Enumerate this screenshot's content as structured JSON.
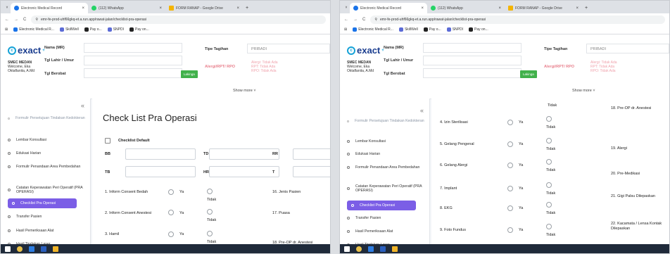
{
  "tabs": [
    {
      "label": "Electronic Medical Record",
      "fav": "#1a73e8"
    },
    {
      "label": "(112) WhatsApp",
      "fav": "#25d366"
    },
    {
      "label": "FORM RANAP - Google Drive",
      "fav": "#f4b400"
    }
  ],
  "caret": "˅",
  "close": "×",
  "plus": "+",
  "nav": {
    "back": "←",
    "fwd": "→",
    "reload": "C",
    "site": "⚲"
  },
  "url": {
    "left": "emr-fe-prod-uhf66gkq-et.a.run.app/rawat-jalan/checklist-pra-operasi",
    "right": "emr-fe-prod-uhf66gkq-et.a.run.app/rawat-jalan/checklist-pra-operasi"
  },
  "bookmarks": [
    {
      "label": "Electronic Medical R...",
      "c": "#1a73e8"
    },
    {
      "label": "SkillWell",
      "c": "#5b6bd6"
    },
    {
      "label": "Pay o...",
      "c": "#222"
    },
    {
      "label": "SNPDI",
      "c": "#5b6bd6"
    },
    {
      "label": "Pay on...",
      "c": "#222"
    }
  ],
  "apps_icon": "⊞",
  "header": {
    "logo": "exact",
    "logo_sup": "+",
    "logo_ring": "c",
    "hospital": "SMEC MEDAN",
    "welcome": "Welcome, Eka",
    "user": "Oktaflanita, A.Md",
    "nama": "Nama (MR)",
    "tgl_lahir": "Tgl Lahir / Umur",
    "tgl_berobat": "Tgl Berobat",
    "btn": "Lakinga",
    "tipe_label": "Tipe Tagihan",
    "tipe_val": "PRIBADI",
    "alert_label": "Alergi/RPT/ RPO",
    "alerts": [
      "Alergi: Tidak Ada",
      "RPT: Tidak Ada",
      "RPO: Tidak Ada"
    ],
    "show_more": "Show more ˅"
  },
  "sidebar": {
    "collapse": "«",
    "items": [
      "Formulir Persetujuan Tindakan Kedokteran",
      "Lembar Konsultasi",
      "Edukasi Harian",
      "Formulir Penandaan Area Pembedahan",
      "Catatan Keperawatan Peri Operatif (PRA OPERASI)",
      "Checklist Pra Operasi",
      "Transfer Pasien",
      "Hasil Pemeriksaan Alat",
      "Hasil Tindakan Laser"
    ]
  },
  "left": {
    "title": "Check List Pra Operasi",
    "checklist_default": "Checklist Default",
    "vitals": [
      "BB",
      "TD",
      "RR",
      "TB",
      "HR",
      "T"
    ],
    "items": [
      {
        "l": "1. Inform Consent Bedah",
        "r": "16. Jenis Pasien"
      },
      {
        "l": "2. Inform Consent Anestesi",
        "r": "17. Puasa"
      },
      {
        "l": "3. Hamil",
        "r": "18. Pre-OP dr. Anestesi"
      }
    ],
    "ya": "Ya",
    "tidak": "Tidak"
  },
  "right": {
    "top_tidak": "Tidak",
    "top_label": "18. Pre-OP dr. Anestesi",
    "items": [
      {
        "l": "4. Izin Sterilisasi",
        "r": ""
      },
      {
        "l": "5. Gelang Pengenal",
        "r": "19. Alergi"
      },
      {
        "l": "6. Gelang Alergi",
        "r": "20. Pre-Medikasi"
      },
      {
        "l": "7. Implant",
        "r": "21. Gigi Palsu Dilepaskan"
      },
      {
        "l": "8. EKG",
        "r": ""
      },
      {
        "l": "9. Foto Fundus",
        "r": "22. Kacamata / Lensa Kontak Dilepaskan"
      }
    ],
    "ya": "Ya",
    "tidak": "Tidak"
  },
  "taskbar": {
    "colors": [
      "#ffffff",
      "#e8c04a",
      "#2d7de2",
      "#2a5ebd",
      "#f0b429"
    ]
  }
}
